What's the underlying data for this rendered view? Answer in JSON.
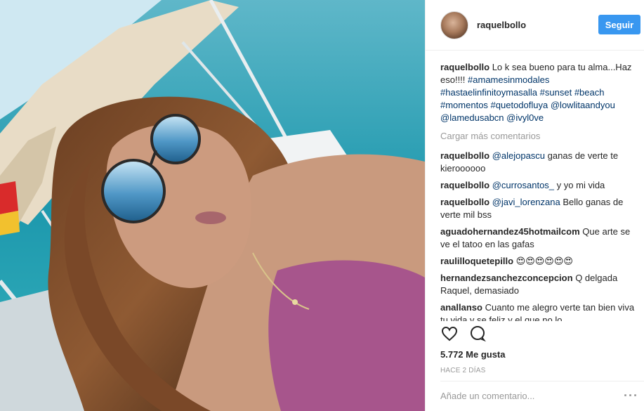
{
  "post": {
    "username": "raquelbollo",
    "follow_label": "Seguir",
    "caption_parts": [
      {
        "text": "Lo k sea bueno para tu alma...Haz eso!!!! ",
        "tag": false
      },
      {
        "text": "#amamesinmodales",
        "tag": true
      },
      {
        "text": " ",
        "tag": false
      },
      {
        "text": "#hastaelinfinitoymasalla",
        "tag": true
      },
      {
        "text": " ",
        "tag": false
      },
      {
        "text": "#sunset",
        "tag": true
      },
      {
        "text": " ",
        "tag": false
      },
      {
        "text": "#beach",
        "tag": true
      },
      {
        "text": " ",
        "tag": false
      },
      {
        "text": "#momentos",
        "tag": true
      },
      {
        "text": " ",
        "tag": false
      },
      {
        "text": "#quetodofluya",
        "tag": true
      },
      {
        "text": " ",
        "tag": false
      },
      {
        "text": "@lowlitaandyou",
        "tag": true
      },
      {
        "text": " ",
        "tag": false
      },
      {
        "text": "@lamedusabcn",
        "tag": true
      },
      {
        "text": " ",
        "tag": false
      },
      {
        "text": "@ivyl0ve",
        "tag": true
      }
    ],
    "load_more": "Cargar más comentarios",
    "comments": [
      {
        "user": "raquelbollo",
        "mention": "@alejopascu",
        "text": " ganas de verte te kieroooooo"
      },
      {
        "user": "raquelbollo",
        "mention": "@currosantos_",
        "text": " y yo mi vida"
      },
      {
        "user": "raquelbollo",
        "mention": "@javi_lorenzana",
        "text": " Bello ganas de verte mil bss"
      },
      {
        "user": "aguadohernandez45hotmailcom",
        "mention": "",
        "text": "Que arte se ve el tatoo en las gafas"
      },
      {
        "user": "raulilloquetepillo",
        "mention": "",
        "text": "😍😍😍😍😍😍"
      },
      {
        "user": "hernandezsanchezconcepcion",
        "mention": "",
        "text": "Q delgada Raquel, demasiado"
      },
      {
        "user": "anallanso",
        "mention": "",
        "text": "Cuanto me alegro verte tan bien viva tu vida y se feliz y el que no lo"
      }
    ],
    "likes": "5.772 Me gusta",
    "time": "HACE 2 DÍAS",
    "comment_placeholder": "Añade un comentario...",
    "more_label": "···",
    "accent_color": "#3897f0",
    "tag_color": "#003569",
    "icons": [
      "heart-icon",
      "comment-icon"
    ]
  }
}
